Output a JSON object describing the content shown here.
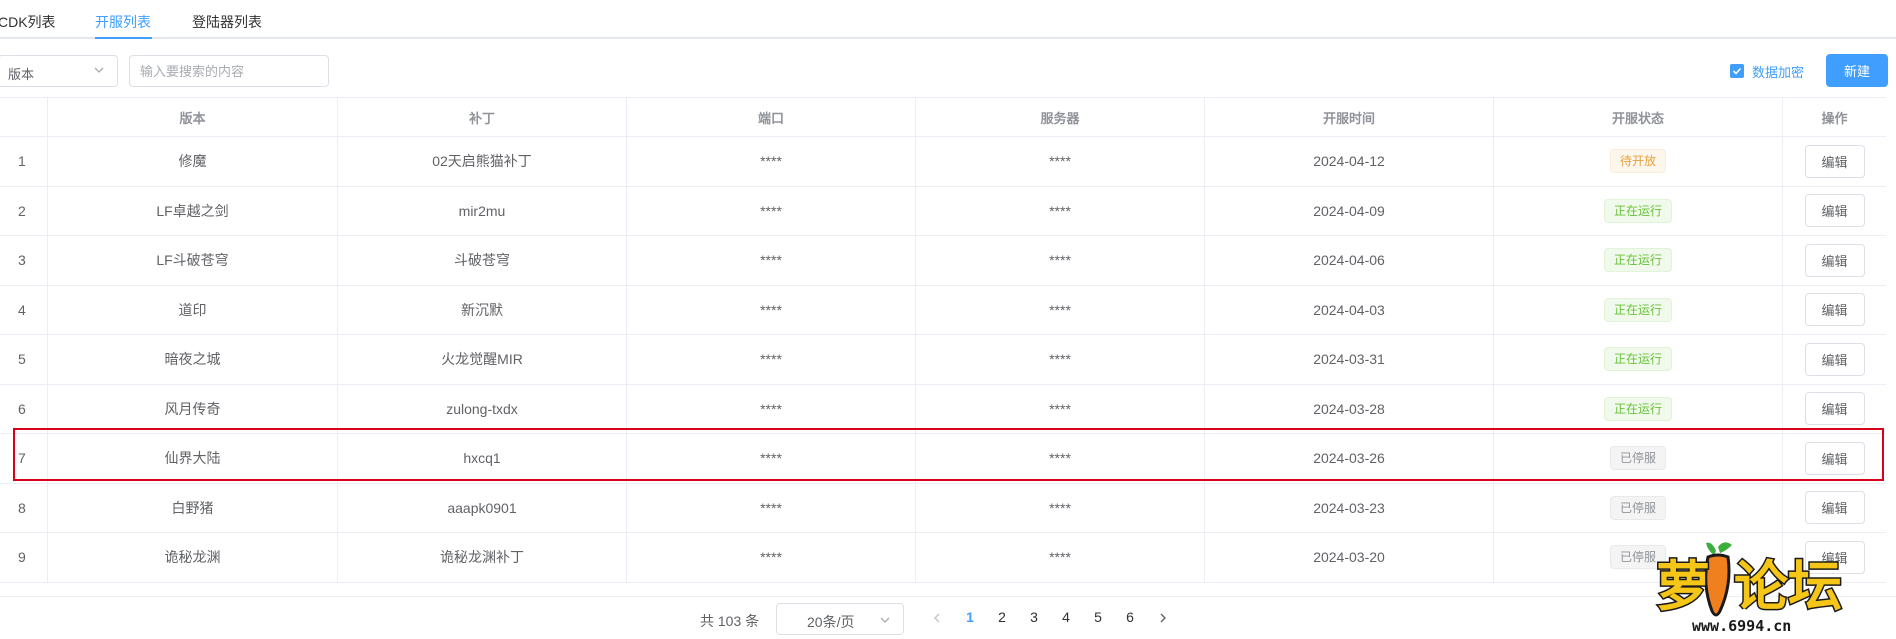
{
  "tabs": [
    {
      "label": "CDK列表"
    },
    {
      "label": "开服列表"
    },
    {
      "label": "登陆器列表"
    }
  ],
  "toolbar": {
    "filter_value": "版本",
    "search_placeholder": "输入要搜索的内容",
    "encrypt_label": "数据加密",
    "encrypt_checked": true,
    "new_label": "新建"
  },
  "table": {
    "headers": [
      "",
      "版本",
      "补丁",
      "端口",
      "服务器",
      "开服时间",
      "开服状态",
      "操作"
    ],
    "rows": [
      {
        "idx": "1",
        "version": "修魔",
        "patch": "02天启熊猫补丁",
        "port": "****",
        "server": "****",
        "date": "2024-04-12",
        "status": "待开放",
        "status_type": "warn",
        "action": "编辑"
      },
      {
        "idx": "2",
        "version": "LF卓越之剑",
        "patch": "mir2mu",
        "port": "****",
        "server": "****",
        "date": "2024-04-09",
        "status": "正在运行",
        "status_type": "ok",
        "action": "编辑"
      },
      {
        "idx": "3",
        "version": "LF斗破苍穹",
        "patch": "斗破苍穹",
        "port": "****",
        "server": "****",
        "date": "2024-04-06",
        "status": "正在运行",
        "status_type": "ok",
        "action": "编辑"
      },
      {
        "idx": "4",
        "version": "道印",
        "patch": "新沉默",
        "port": "****",
        "server": "****",
        "date": "2024-04-03",
        "status": "正在运行",
        "status_type": "ok",
        "action": "编辑"
      },
      {
        "idx": "5",
        "version": "暗夜之城",
        "patch": "火龙觉醒MIR",
        "port": "****",
        "server": "****",
        "date": "2024-03-31",
        "status": "正在运行",
        "status_type": "ok",
        "action": "编辑"
      },
      {
        "idx": "6",
        "version": "风月传奇",
        "patch": "zulong-txdx",
        "port": "****",
        "server": "****",
        "date": "2024-03-28",
        "status": "正在运行",
        "status_type": "ok",
        "action": "编辑"
      },
      {
        "idx": "7",
        "version": "仙界大陆",
        "patch": "hxcq1",
        "port": "****",
        "server": "****",
        "date": "2024-03-26",
        "status": "已停服",
        "status_type": "stop",
        "action": "编辑"
      },
      {
        "idx": "8",
        "version": "白野猪",
        "patch": "aaapk0901",
        "port": "****",
        "server": "****",
        "date": "2024-03-23",
        "status": "已停服",
        "status_type": "stop",
        "action": "编辑"
      },
      {
        "idx": "9",
        "version": "诡秘龙渊",
        "patch": "诡秘龙渊补丁",
        "port": "****",
        "server": "****",
        "date": "2024-03-20",
        "status": "已停服",
        "status_type": "stop",
        "action": "编辑"
      }
    ]
  },
  "pagination": {
    "total": "共 103 条",
    "page_size": "20条/页",
    "pages": [
      "1",
      "2",
      "3",
      "4",
      "5",
      "6"
    ],
    "current": "1"
  },
  "watermark": {
    "text": "萝卜论坛",
    "url": "www.6994.cn"
  },
  "colors": {
    "primary": "#409eff",
    "warning": "#e6a23c",
    "success": "#67c23a",
    "info": "#909399",
    "highlight": "#d9001b"
  }
}
